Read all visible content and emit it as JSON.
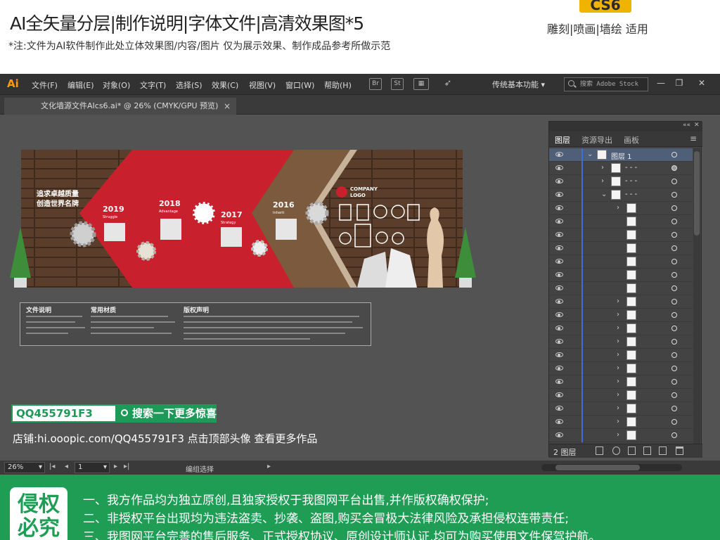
{
  "header": {
    "title": "AI全矢量分层|制作说明|字体文件|高清效果图*5",
    "note": "*注:文件为AI软件制作此处立体效果图/内容/图片 仅为展示效果、制作成品参考所做示范",
    "badge": "CS6",
    "usage": "雕刻|喷画|墙绘 适用"
  },
  "app": {
    "logo": "Ai",
    "menus": [
      "文件(F)",
      "编辑(E)",
      "对象(O)",
      "文字(T)",
      "选择(S)",
      "效果(C)",
      "视图(V)",
      "窗口(W)",
      "帮助(H)"
    ],
    "toolbar_icons": [
      "Br",
      "St"
    ],
    "workspace": "传统基本功能",
    "stock_placeholder": "搜索 Adobe Stock",
    "doc_tab": "文化墙源文件AIcs6.ai* @ 26% (CMYK/GPU 预览)",
    "doc_close": "×"
  },
  "artwork": {
    "slogan_1": "追求卓越质量",
    "slogan_2": "创造世界名牌",
    "years": [
      {
        "year": "2019",
        "sub": "Struggle"
      },
      {
        "year": "2018",
        "sub": "Advantage"
      },
      {
        "year": "2017",
        "sub": "Strategy"
      },
      {
        "year": "2016",
        "sub": "Inherit"
      }
    ],
    "company_1": "COMPANY",
    "company_2": "LOGO",
    "info_headers": [
      "文件说明",
      "常用材质",
      "版权声明"
    ]
  },
  "promo": {
    "qq": "QQ455791F3",
    "search_btn": "搜索一下更多惊喜",
    "shop": "店铺:hi.ooopic.com/QQ455791F3  点击顶部头像 查看更多作品"
  },
  "statusbar": {
    "zoom": "26%",
    "page": "1",
    "edit": "编组选择"
  },
  "layers_panel": {
    "tabs": [
      "图层",
      "资源导出",
      "画板"
    ],
    "top_layer": "图层 1",
    "sublayer_name": "- - -",
    "count": "2 图层"
  },
  "banner": {
    "stamp": "侵权必究",
    "lines": [
      "一、我方作品均为独立原创,且独家授权于我图网平台出售,并作版权确权保护;",
      "二、非授权平台出现均为违法盗卖、抄袭、盗图,购买会冒极大法律风险及承担侵权连带责任;",
      "三、我图网平台完善的售后服务、正式授权协议、原创设计师认证,均可为购买使用文件保驾护航。"
    ]
  },
  "colors": {
    "accent_green": "#1f9d55",
    "badge_yellow": "#f0b400",
    "ai_orange": "#ff9a00",
    "wall_red": "#c8202c",
    "wall_brown": "#6b4a32"
  }
}
